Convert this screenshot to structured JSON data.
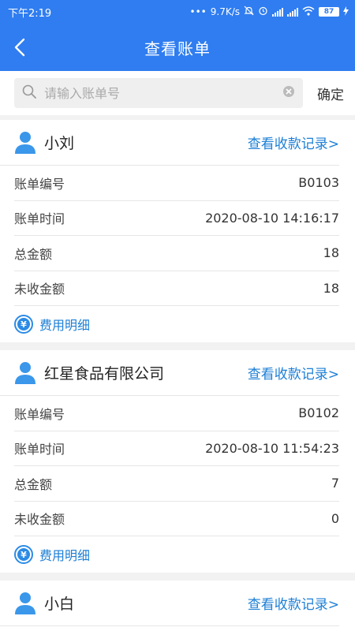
{
  "status": {
    "time": "下午2:19",
    "net_speed": "9.7K/s",
    "battery": "87"
  },
  "nav": {
    "title": "查看账单"
  },
  "search": {
    "placeholder": "请输入账单号",
    "value": "",
    "confirm_label": "确定"
  },
  "labels": {
    "bill_no": "账单编号",
    "bill_time": "账单时间",
    "total": "总金额",
    "uncollected": "未收金额",
    "view_records": "查看收款记录>",
    "fee_detail": "费用明细"
  },
  "bills": [
    {
      "customer": "小刘",
      "bill_no": "B0103",
      "bill_time": "2020-08-10 14:16:17",
      "total": "18",
      "uncollected": "18"
    },
    {
      "customer": "红星食品有限公司",
      "bill_no": "B0102",
      "bill_time": "2020-08-10 11:54:23",
      "total": "7",
      "uncollected": "0"
    },
    {
      "customer": "小白"
    }
  ],
  "colors": {
    "primary": "#2f7df0",
    "link": "#1d7fd6"
  }
}
